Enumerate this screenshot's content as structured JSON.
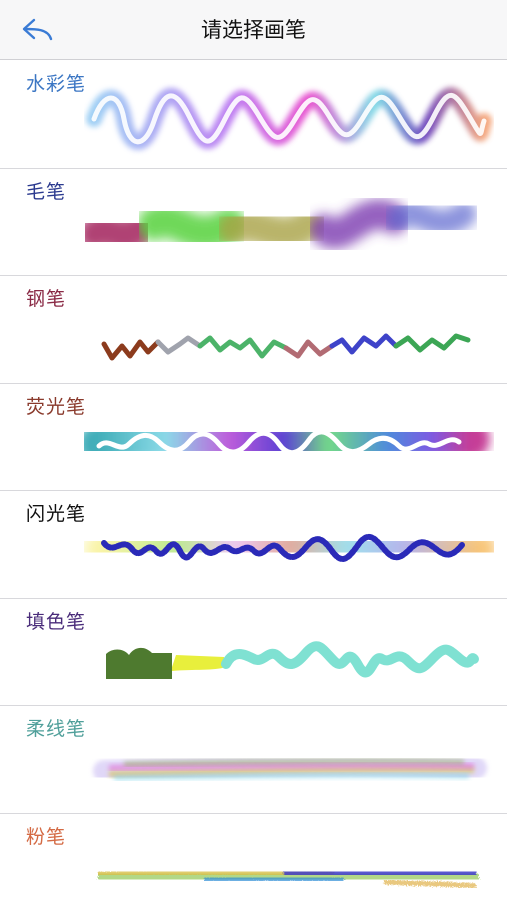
{
  "nav": {
    "title": "请选择画笔",
    "back_icon": "back-arrow-icon",
    "accent": "#3a7bd5"
  },
  "brushes": [
    {
      "label": "水彩笔",
      "color": "#3b76c3"
    },
    {
      "label": "毛笔",
      "color": "#2b3a8f"
    },
    {
      "label": "钢笔",
      "color": "#8a2a45"
    },
    {
      "label": "荧光笔",
      "color": "#8a3a2c"
    },
    {
      "label": "闪光笔",
      "color": "#111111"
    },
    {
      "label": "填色笔",
      "color": "#4a2c7a"
    },
    {
      "label": "柔线笔",
      "color": "#4f9f9a"
    },
    {
      "label": "粉笔",
      "color": "#d46a44"
    }
  ]
}
